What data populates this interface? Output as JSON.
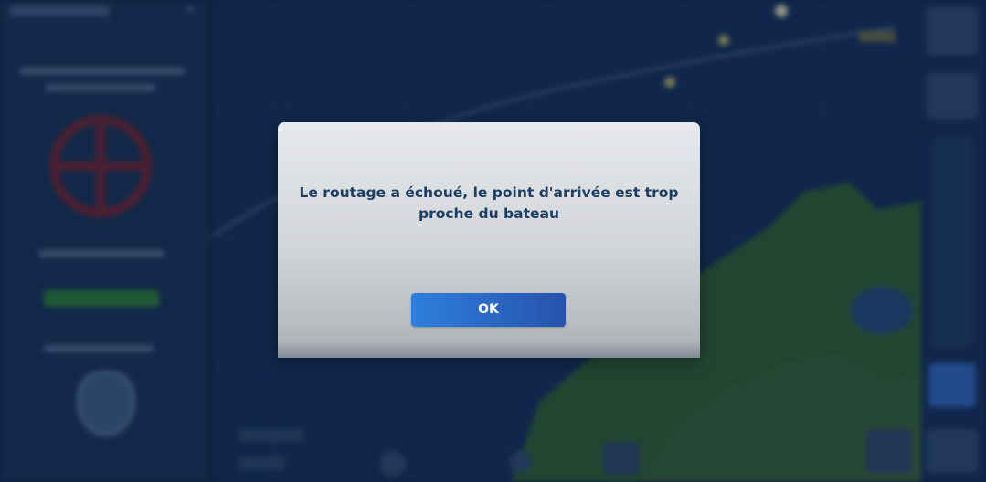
{
  "dialog": {
    "message": "Le routage a échoué, le point d'arrivée est trop proche du bateau",
    "ok_label": "OK"
  },
  "colors": {
    "dialog_text": "#1d3e63",
    "ok_button_start": "#2e7fdd",
    "ok_button_end": "#2653ad",
    "sea": "#11294a",
    "land": "#2f5c35"
  },
  "icons": {
    "left_panel_emblem": "crosshair-emblem-icon",
    "left_panel_badge": "shield-icon",
    "left_panel_close": "close-icon"
  }
}
